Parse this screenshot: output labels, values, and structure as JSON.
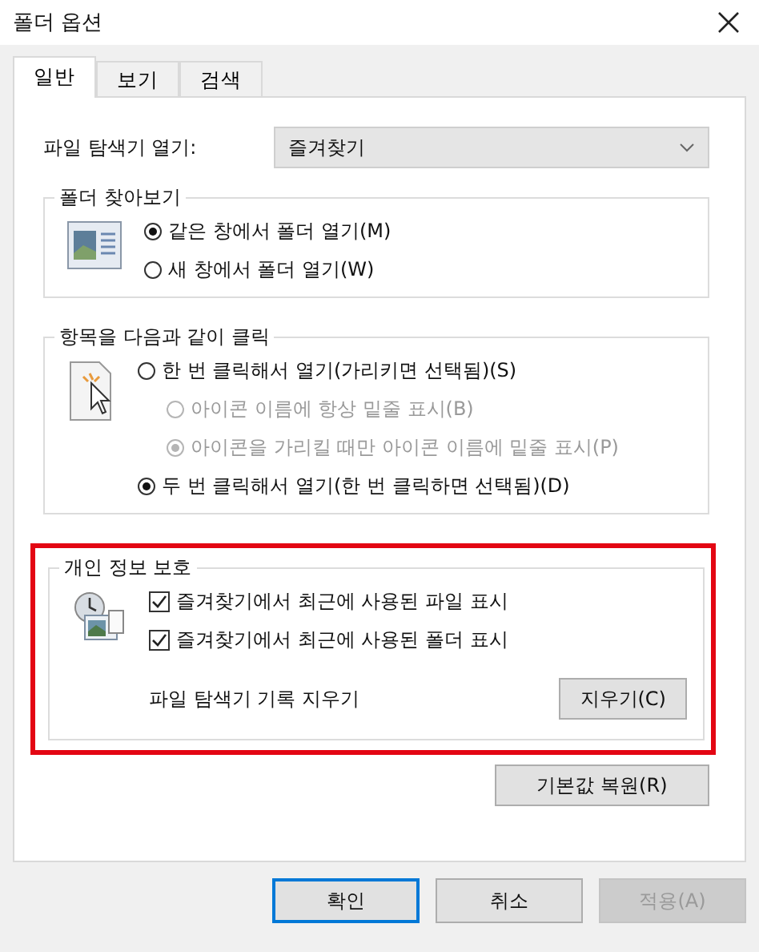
{
  "window": {
    "title": "폴더 옵션"
  },
  "tabs": [
    {
      "label": "일반",
      "selected": true
    },
    {
      "label": "보기",
      "selected": false
    },
    {
      "label": "검색",
      "selected": false
    }
  ],
  "open_explorer": {
    "label": "파일 탐색기 열기:",
    "value": "즐겨찾기"
  },
  "browse_folders": {
    "title": "폴더 찾아보기",
    "options": [
      {
        "label": "같은 창에서 폴더 열기(M)",
        "selected": true
      },
      {
        "label": "새 창에서 폴더 열기(W)",
        "selected": false
      }
    ]
  },
  "click_items": {
    "title": "항목을 다음과 같이 클릭",
    "options": [
      {
        "label": "한 번 클릭해서 열기(가리키면 선택됨)(S)",
        "selected": false,
        "disabled": false,
        "children": [
          {
            "label": "아이콘 이름에 항상 밑줄 표시(B)",
            "selected": false,
            "disabled": true
          },
          {
            "label": "아이콘을 가리킬 때만 아이콘 이름에 밑줄 표시(P)",
            "selected": true,
            "disabled": true
          }
        ]
      },
      {
        "label": "두 번 클릭해서 열기(한 번 클릭하면 선택됨)(D)",
        "selected": true,
        "disabled": false
      }
    ]
  },
  "privacy": {
    "title": "개인 정보 보호",
    "highlighted": true,
    "checks": [
      {
        "label": "즐겨찾기에서 최근에 사용된 파일 표시",
        "checked": true
      },
      {
        "label": "즐겨찾기에서 최근에 사용된 폴더 표시",
        "checked": true
      }
    ],
    "clear_label": "파일 탐색기 기록 지우기",
    "clear_button": "지우기(C)"
  },
  "restore_button": "기본값 복원(R)",
  "buttons": [
    {
      "label": "확인",
      "default": true,
      "disabled": false
    },
    {
      "label": "취소",
      "default": false,
      "disabled": false
    },
    {
      "label": "적용(A)",
      "default": false,
      "disabled": true
    }
  ]
}
